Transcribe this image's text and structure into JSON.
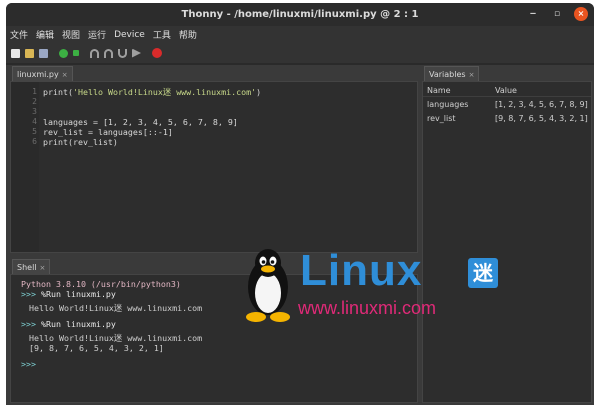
{
  "window": {
    "title": "Thonny  -  /home/linuxmi/linuxmi.py  @  2 : 1",
    "controls": {
      "minimize": "‒",
      "maximize": "▫",
      "close": "×"
    }
  },
  "menu": [
    "文件",
    "编辑",
    "视图",
    "运行",
    "Device",
    "工具",
    "帮助"
  ],
  "toolbar": {
    "icons": [
      "new-file-icon",
      "open-file-icon",
      "save-icon",
      "run-icon",
      "debug-icon",
      "step-over-icon",
      "step-into-icon",
      "step-out-icon",
      "resume-icon",
      "stop-icon"
    ]
  },
  "editor": {
    "tab": {
      "label": "linuxmi.py",
      "close": "×"
    },
    "line_numbers": [
      "1",
      "2",
      "3",
      "4",
      "5",
      "6"
    ],
    "lines": [
      {
        "pre": "print(",
        "str": "'Hello World!Linux迷 www.linuxmi.com'",
        "post": ")"
      },
      {
        "pre": "",
        "str": "",
        "post": ""
      },
      {
        "pre": "",
        "str": "",
        "post": ""
      },
      {
        "pre": "languages = [1, 2, 3, 4, 5, 6, 7, 8, 9]",
        "str": "",
        "post": ""
      },
      {
        "pre": "rev_list = languages[::-1]",
        "str": "",
        "post": ""
      },
      {
        "pre": "print(rev_list)",
        "str": "",
        "post": ""
      }
    ]
  },
  "variables": {
    "tab": {
      "label": "Variables",
      "close": "×"
    },
    "columns": [
      "Name",
      "Value"
    ],
    "rows": [
      {
        "name": "languages",
        "value": "[1, 2, 3, 4, 5, 6, 7, 8, 9]"
      },
      {
        "name": "rev_list",
        "value": "[9, 8, 7, 6, 5, 4, 3, 2, 1]"
      }
    ]
  },
  "shell": {
    "tab": {
      "label": "Shell",
      "close": "×"
    },
    "header": "Python 3.8.10 (/usr/bin/python3)",
    "prompt": ">>>",
    "cmd1": "%Run linuxmi.py",
    "out1": "Hello World!Linux迷 www.linuxmi.com",
    "cmd2": "%Run linuxmi.py",
    "out2a": "Hello World!Linux迷 www.linuxmi.com",
    "out2b": "[9, 8, 7, 6, 5, 4, 3, 2, 1]"
  },
  "watermark": {
    "word": "Linux",
    "badge": "迷",
    "url": "www.linuxmi.com"
  },
  "colors": {
    "accent_close": "#e95420",
    "watermark_blue": "#2f8ed8",
    "watermark_pink": "#e02a78",
    "string_green": "#c8d98a",
    "prompt_cyan": "#7fd3d6"
  }
}
